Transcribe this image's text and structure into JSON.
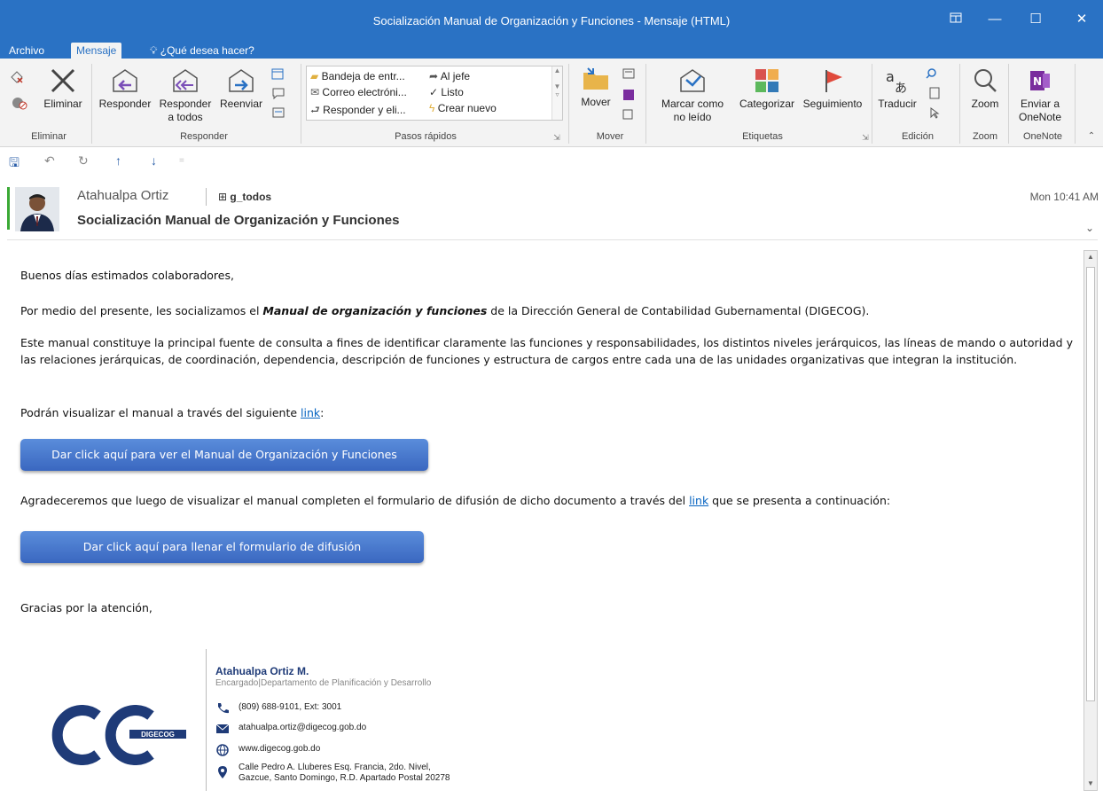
{
  "window": {
    "title": "Socialización Manual de Organización y Funciones - Mensaje (HTML)",
    "controls": [
      "restore-ribbon",
      "minimize",
      "maximize",
      "close"
    ]
  },
  "tabs": [
    {
      "label": "Archivo"
    },
    {
      "label": "Mensaje"
    },
    {
      "label": "¿Qué desea hacer?"
    }
  ],
  "ribbon": {
    "eliminar": {
      "delete_label": "Eliminar",
      "group": "Eliminar"
    },
    "responder": {
      "reply_label": "Responder",
      "reply_all_line1": "Responder",
      "reply_all_line2": "a todos",
      "forward_label": "Reenviar",
      "group": "Responder"
    },
    "quick_steps": {
      "items": [
        "Bandeja de entr...",
        "Correo electróni...",
        "Responder y eli...",
        "Al jefe",
        "Listo",
        "Crear nuevo"
      ],
      "group": "Pasos rápidos"
    },
    "mover": {
      "move_label": "Mover",
      "group": "Mover"
    },
    "etiquetas": {
      "mark_line1": "Marcar como",
      "mark_line2": "no leído",
      "categorize_label": "Categorizar",
      "followup_label": "Seguimiento",
      "group": "Etiquetas"
    },
    "edicion": {
      "translate_label": "Traducir",
      "group": "Edición"
    },
    "zoom": {
      "zoom_label": "Zoom",
      "group": "Zoom"
    },
    "onenote": {
      "line1": "Enviar a",
      "line2": "OneNote",
      "group": "OneNote"
    }
  },
  "message": {
    "sender": "Atahualpa Ortiz",
    "to": "g_todos",
    "subject": "Socialización Manual de Organización y Funciones",
    "date": "Mon 10:41 AM",
    "body": {
      "greeting": "Buenos días estimados colaboradores,",
      "p1_before": "Por medio del presente, les socializamos el ",
      "p1_emph": "Manual de organización y funciones",
      "p1_after": " de la Dirección General de Contabilidad Gubernamental (DIGECOG).",
      "p2": "Este manual constituye la principal fuente de consulta a fines de identificar claramente las funciones y responsabilidades, los distintos niveles jerárquicos, las líneas de mando o autoridad y las relaciones jerárquicas, de coordinación, dependencia, descripción de funciones y estructura de cargos entre cada una de las unidades organizativas que integran la institución.",
      "p3_before": "Podrán visualizar el manual a través del siguiente ",
      "p3_link": "link",
      "p3_after": ":",
      "button1": "Dar click aquí para ver el Manual de Organización y Funciones",
      "p4_before": "Agradeceremos que luego de visualizar el manual completen el formulario de difusión de dicho documento a través del ",
      "p4_link": "link",
      "p4_after": " que se presenta a continuación:",
      "button2": "Dar click aquí para llenar el formulario de difusión",
      "closing": "Gracias por la atención,"
    },
    "signature": {
      "logo_text": "DIGECOG",
      "name": "Atahualpa Ortiz M.",
      "role": "Encargado|Departamento de Planificación y Desarrollo",
      "phone": "(809) 688-9101, Ext: 3001",
      "email": "atahualpa.ortiz@digecog.gob.do",
      "web": "www.digecog.gob.do",
      "address_line1": "Calle Pedro A. Lluberes Esq. Francia, 2do. Nivel,",
      "address_line2": "Gazcue, Santo Domingo, R.D. Apartado Postal 20278"
    }
  },
  "colors": {
    "accent": "#2a72c4",
    "button": "#4a7bd0",
    "link": "#0563c1",
    "presence": "#3aa935",
    "brand": "#1f3b78"
  }
}
